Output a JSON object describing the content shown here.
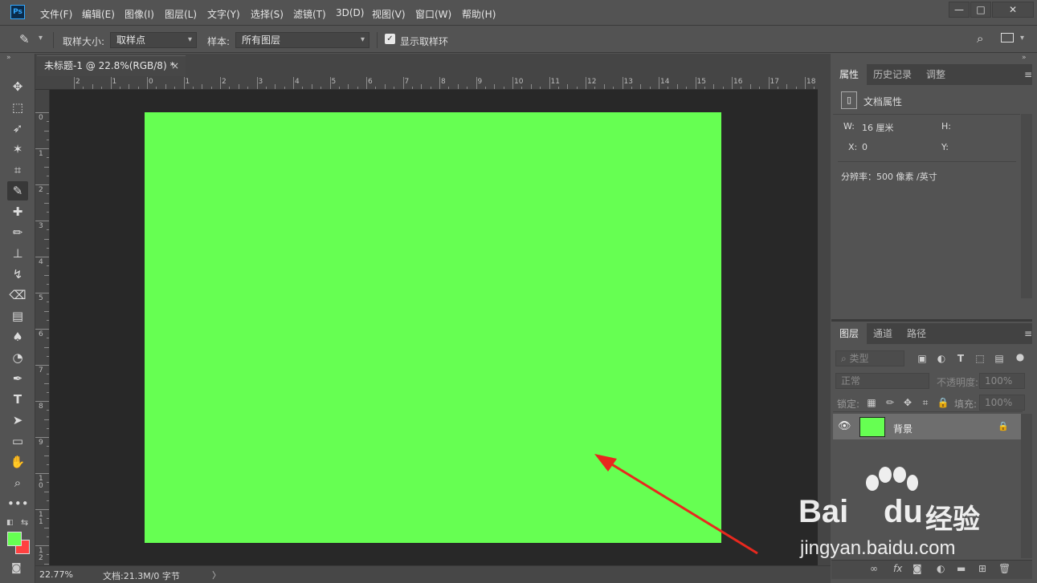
{
  "app": {
    "logo": "Ps"
  },
  "menu": [
    "文件(F)",
    "编辑(E)",
    "图像(I)",
    "图层(L)",
    "文字(Y)",
    "选择(S)",
    "滤镜(T)",
    "3D(D)",
    "视图(V)",
    "窗口(W)",
    "帮助(H)"
  ],
  "window_buttons": {
    "minimize": "—",
    "maximize": "□",
    "close": "✕"
  },
  "options": {
    "sample_size_label": "取样大小:",
    "sample_size_value": "取样点",
    "sample_label": "样本:",
    "sample_value": "所有图层",
    "show_ring_label": "显示取样环",
    "show_ring_checked": true
  },
  "document": {
    "tab_title": "未标题-1 @ 22.8%(RGB/8) *",
    "close": "×",
    "canvas_color": "#66ff52"
  },
  "rulers": {
    "h_labels": [
      "2",
      "1",
      "0",
      "1",
      "2",
      "3",
      "4",
      "5",
      "6",
      "7",
      "8",
      "9",
      "10",
      "11",
      "12",
      "13",
      "14",
      "15",
      "16",
      "17",
      "18"
    ],
    "v_labels": [
      "0",
      "1",
      "2",
      "3",
      "4",
      "5",
      "6",
      "7",
      "8",
      "9",
      "10",
      "11",
      "12"
    ]
  },
  "status": {
    "zoom": "22.77%",
    "doc_info": "文档:21.3M/0 字节",
    "arrow": "〉"
  },
  "colors": {
    "foreground": "#66ff52",
    "background": "#ff4040"
  },
  "properties_panel": {
    "tabs": [
      "属性",
      "历史记录",
      "调整"
    ],
    "section_title": "文档属性",
    "w_label": "W:",
    "w_value": "16 厘米",
    "h_label": "H:",
    "x_label": "X:",
    "x_value": "0",
    "y_label": "Y:",
    "resolution": "分辨率：500 像素 /英寸"
  },
  "layers_panel": {
    "tabs": [
      "图层",
      "通道",
      "路径"
    ],
    "filter_placeholder": "类型",
    "blend_mode": "正常",
    "opacity_label": "不透明度:",
    "opacity_value": "100%",
    "lock_label": "锁定:",
    "fill_label": "填充:",
    "fill_value": "100%",
    "layers": [
      {
        "name": "背景",
        "visible": true,
        "locked": true
      }
    ]
  },
  "watermark": {
    "brand": "Bai",
    "brand2": "du",
    "cn": "经验",
    "url": "jingyan.baidu.com"
  }
}
